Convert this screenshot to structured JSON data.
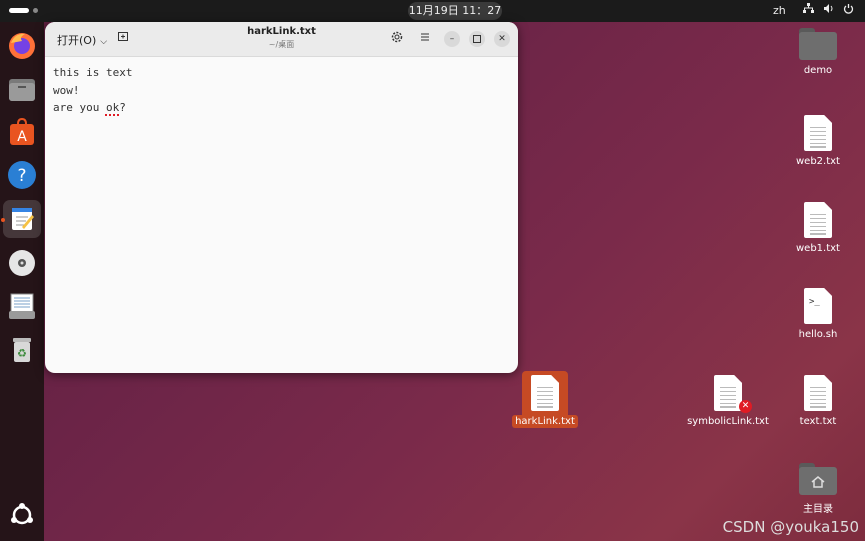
{
  "topbar": {
    "clock": "11月19日  11：27",
    "lang": "zh",
    "tray_icons": [
      "network-icon",
      "volume-icon",
      "power-icon"
    ]
  },
  "dock": {
    "apps": [
      "firefox-icon",
      "files-icon",
      "app-center-icon",
      "help-icon",
      "text-editor-icon",
      "disc-icon",
      "document-scanner-icon",
      "trash-icon"
    ],
    "bottom": "ubuntu-show-apps-icon"
  },
  "window": {
    "open_label": "打开(O)",
    "title": "harkLink.txt",
    "subtitle": "~/桌面",
    "lines": [
      "this is text",
      "wow!"
    ],
    "line3_pre": "are you ",
    "line3_spell": "ok",
    "line3_post": "?"
  },
  "desktop": {
    "demo": "demo",
    "web2": "web2.txt",
    "web1": "web1.txt",
    "hello": "hello.sh",
    "hark": "harkLink.txt",
    "symbolic": "symbolicLink.txt",
    "text": "text.txt",
    "home": "主目录"
  },
  "watermark": "CSDN @youka150",
  "colors": {
    "accent": "#e95420",
    "selection": "#c64a24",
    "error": "#e01b24"
  }
}
